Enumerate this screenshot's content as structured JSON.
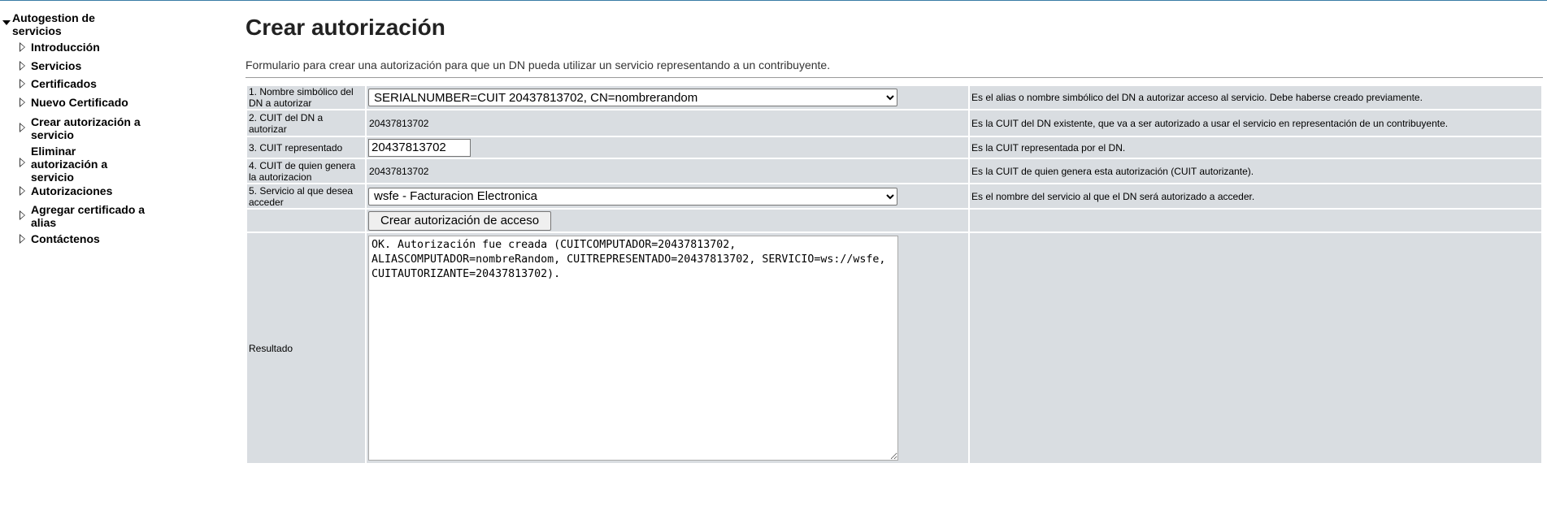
{
  "sidebar": {
    "root": "Autogestion de servicios",
    "items": [
      {
        "label": "Introducción"
      },
      {
        "label": "Servicios"
      },
      {
        "label": "Certificados"
      },
      {
        "label": "Nuevo Certificado"
      },
      {
        "label": "Crear autorización a servicio"
      },
      {
        "label": "Eliminar autorización a servicio"
      },
      {
        "label": "Autorizaciones"
      },
      {
        "label": "Agregar certificado a alias"
      },
      {
        "label": "Contáctenos"
      }
    ]
  },
  "page": {
    "title": "Crear autorización",
    "description": "Formulario para crear una autorización para que un DN pueda utilizar un servicio representando a un contribuyente."
  },
  "form": {
    "rows": [
      {
        "label": "1. Nombre simbólico del DN a autorizar",
        "value": "SERIALNUMBER=CUIT 20437813702, CN=nombrerandom",
        "help": "Es el alias o nombre simbólico del DN a autorizar acceso al servicio. Debe haberse creado previamente."
      },
      {
        "label": "2. CUIT del DN a autorizar",
        "value": "20437813702",
        "help": "Es la CUIT del DN existente, que va a ser autorizado a usar el servicio en representación de un contribuyente."
      },
      {
        "label": "3. CUIT representado",
        "value": "20437813702",
        "help": "Es la CUIT representada por el DN."
      },
      {
        "label": "4. CUIT de quien genera la autorizacion",
        "value": "20437813702",
        "help": "Es la CUIT de quien genera esta autorización (CUIT autorizante)."
      },
      {
        "label": "5. Servicio al que desea acceder",
        "value": "wsfe - Facturacion Electronica",
        "help": "Es el nombre del servicio al que el DN será autorizado a acceder."
      }
    ],
    "submit_label": "Crear autorización de acceso",
    "result_label": "Resultado",
    "result_text": "OK. Autorización fue creada (CUITCOMPUTADOR=20437813702, ALIASCOMPUTADOR=nombreRandom, CUITREPRESENTADO=20437813702, SERVICIO=ws://wsfe, CUITAUTORIZANTE=20437813702)."
  }
}
